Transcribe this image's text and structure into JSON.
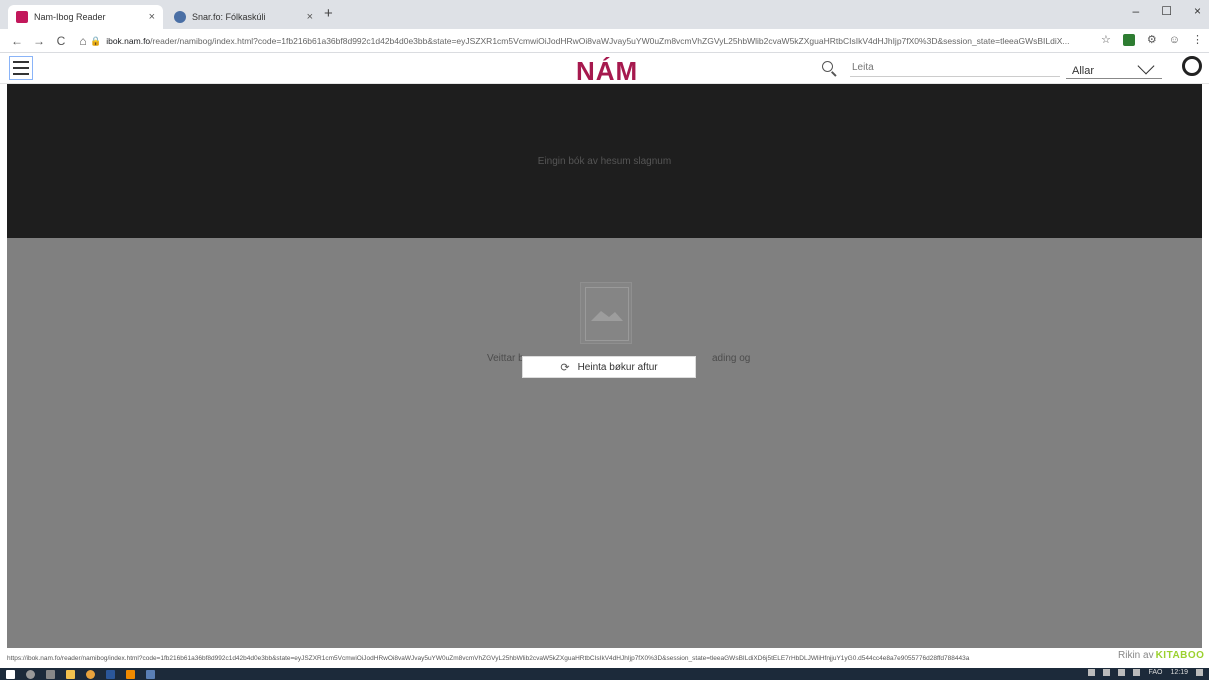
{
  "browser": {
    "tabs": [
      {
        "title": "Nam-Ibog Reader",
        "close": "×",
        "favicon_color": "#c2185b"
      },
      {
        "title": "Snar.fo: Fólkaskúli",
        "close": "×",
        "favicon_color": "#4a6fa5"
      }
    ],
    "new_tab": "+",
    "window": {
      "minimize": "–",
      "maximize": "☐",
      "close": "×"
    },
    "nav": {
      "back": "←",
      "forward": "→",
      "reload": "C",
      "home": "⌂"
    },
    "url_host": "ibok.nam.fo",
    "url_path": "/reader/namibog/index.html?code=1fb216b61a36bf8d992c1d42b4d0e3bb&state=eyJSZXR1cm5VcmwiOiJodHRwOi8vaWJvay5uYW0uZm8vcmVhZGVyL25hbWlib2cvaW5kZXguaHRtbCIsIkV4dHJhIjp7fX0%3D&session_state=tleeaGWsBILdiX...",
    "status_url": "https://ibok.nam.fo/reader/namibog/index.html?code=1fb216b61a36bf8d992c1d42b4d0e3bb&state=eyJSZXR1cm5VcmwiOiJodHRwOi8vaWJvay5uYW0uZm8vcmVhZGVyL25hbWlib2cvaW5kZXguaHRtbCIsIkV4dHJhIjp7fX0%3D&session_state=tleeaGWsBILdiXD6j5tELE7rHbDLJWliHfnjjuY1yG0.d544cc4e8a7e9055776d28ffd788443a"
  },
  "app": {
    "logo": "NÁM",
    "search_placeholder": "Leita",
    "filter_label": "Allar",
    "empty_message": "Eingin bók av hesum slagnum",
    "behind_text_left": "Veittar b",
    "behind_text_right": "ading og",
    "retry_label": "Heinta bøkur aftur",
    "powered_by": "Rikin av",
    "brand": "KITABOO"
  },
  "taskbar": {
    "language": "FAO",
    "time": "12:19"
  },
  "colors": {
    "brand": "#a6194e",
    "kitaboo": "#9bd12f"
  }
}
